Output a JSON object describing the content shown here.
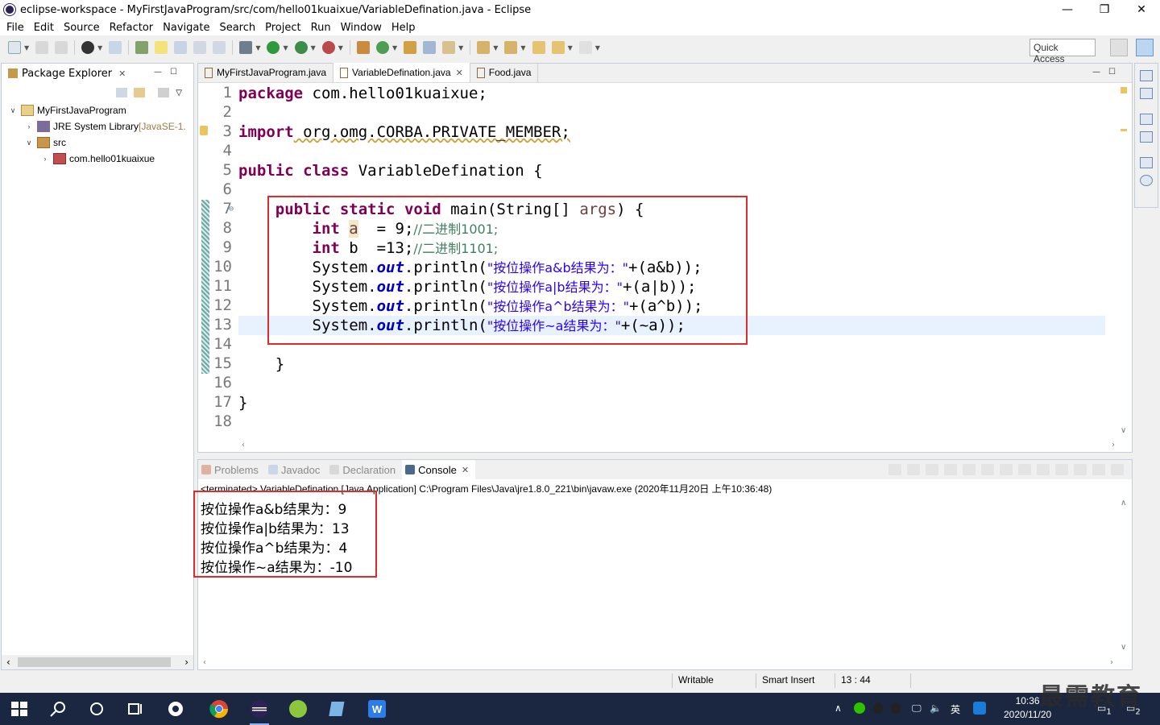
{
  "window": {
    "title": "eclipse-workspace - MyFirstJavaProgram/src/com/hello01kuaixue/VariableDefination.java - Eclipse",
    "controls": {
      "minimize": "—",
      "restore": "❐",
      "close": "✕"
    }
  },
  "menu": [
    "File",
    "Edit",
    "Source",
    "Refactor",
    "Navigate",
    "Search",
    "Project",
    "Run",
    "Window",
    "Help"
  ],
  "toolbar": {
    "quick_access": "Quick Access"
  },
  "package_explorer": {
    "title": "Package Explorer",
    "tree": [
      {
        "label": "MyFirstJavaProgram",
        "suffix": ""
      },
      {
        "label": "JRE System Library",
        "suffix": " [JavaSE-1."
      },
      {
        "label": "src",
        "suffix": ""
      },
      {
        "label": "com.hello01kuaixue",
        "suffix": ""
      }
    ]
  },
  "editor": {
    "tabs": [
      "MyFirstJavaProgram.java",
      "VariableDefination.java",
      "Food.java"
    ],
    "line_numbers": [
      "1",
      "2",
      "3",
      "4",
      "5",
      "6",
      "7",
      "8",
      "9",
      "10",
      "11",
      "12",
      "13",
      "14",
      "15",
      "16",
      "17",
      "18"
    ],
    "lines": {
      "l1": {
        "kw": "package",
        "rest": " com.hello01kuaixue;"
      },
      "l3": {
        "kw": "import",
        "rest": " org.omg.CORBA.PRIVATE_MEMBER;"
      },
      "l5": {
        "kw1": "public",
        "kw2": "class",
        "rest": " VariableDefination {"
      },
      "l7": {
        "indent": "    ",
        "kw1": "public",
        "kw2": "static",
        "kw3": "void",
        "mid": " main(String[] ",
        "arg": "args",
        "end": ") {"
      },
      "l8": {
        "indent": "        ",
        "kw": "int",
        "var": "a",
        "mid": "  = 9;",
        "comment": "//二进制1001;"
      },
      "l9": {
        "indent": "        ",
        "kw": "int",
        "mid": " b  =13;",
        "comment": "//二进制1101;"
      },
      "l10": {
        "indent": "        ",
        "pre": "System.",
        "field": "out",
        "call": ".println(",
        "str": "\"按位操作a&b结果为：\"",
        "end": "+(a&b));"
      },
      "l11": {
        "indent": "        ",
        "pre": "System.",
        "field": "out",
        "call": ".println(",
        "str": "\"按位操作a|b结果为：\"",
        "end": "+(a|b));"
      },
      "l12": {
        "indent": "        ",
        "pre": "System.",
        "field": "out",
        "call": ".println(",
        "str": "\"按位操作a^b结果为：\"",
        "end": "+(a^b));"
      },
      "l13": {
        "indent": "        ",
        "pre": "System.",
        "field": "out",
        "call": ".println(",
        "str": "\"按位操作~a结果为：\"",
        "end": "+(~a));"
      },
      "l15": {
        "text": "    }"
      },
      "l17": {
        "text": "}"
      }
    }
  },
  "console": {
    "tabs": [
      "Problems",
      "Javadoc",
      "Declaration",
      "Console"
    ],
    "terminated": "<terminated> VariableDefination [Java Application] C:\\Program Files\\Java\\jre1.8.0_221\\bin\\javaw.exe (2020年11月20日 上午10:36:48)",
    "output": [
      "按位操作a&b结果为：9",
      "按位操作a|b结果为：13",
      "按位操作a^b结果为：4",
      "按位操作~a结果为：-10"
    ]
  },
  "status_bar": {
    "writable": "Writable",
    "insert_mode": "Smart Insert",
    "position": "13 : 44"
  },
  "taskbar": {
    "clock_time": "10:36",
    "clock_date": "2020/11/20",
    "ime": "英",
    "notification_count": "1",
    "chat_count": "2"
  },
  "watermark": "最需教育",
  "colors": {
    "keyword": "#7f0055",
    "comment": "#3f7f5f",
    "string": "#2a00ff",
    "field": "#0000c0",
    "highlight_box": "#e02b2b",
    "taskbar": "#1b2740"
  }
}
